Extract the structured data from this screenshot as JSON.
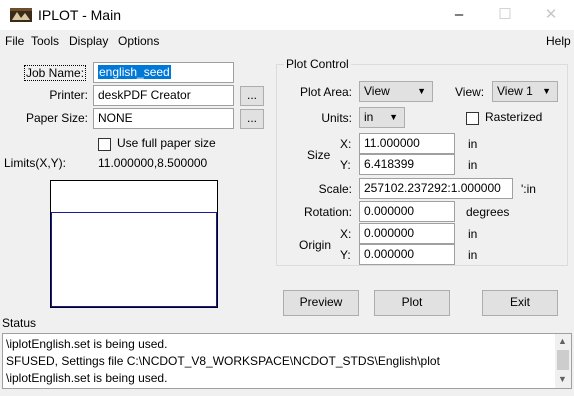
{
  "window": {
    "title": "IPLOT - Main",
    "minimize_glyph": "–",
    "maximize_glyph": "☐",
    "close_glyph": "✕"
  },
  "menu": {
    "file": "File",
    "tools": "Tools",
    "display": "Display",
    "options": "Options",
    "help": "Help"
  },
  "left": {
    "job_name_label": "Job Name:",
    "job_name_value": "english_seed",
    "printer_label": "Printer:",
    "printer_value": "deskPDF Creator",
    "paper_size_label": "Paper Size:",
    "paper_size_value": "NONE",
    "browse_label": "...",
    "use_full_paper_label": "Use full paper size",
    "use_full_paper_checked": false,
    "limits_label": "Limits(X,Y):",
    "limits_value": "11.000000,8.500000"
  },
  "plot_control": {
    "title": "Plot Control",
    "plot_area_label": "Plot Area:",
    "plot_area_value": "View",
    "view_label": "View:",
    "view_value": "View 1",
    "units_label": "Units:",
    "units_value": "in",
    "rasterized_label": "Rasterized",
    "rasterized_checked": false,
    "size_label": "Size",
    "size_x_label": "X:",
    "size_x_value": "11.000000",
    "size_x_unit": "in",
    "size_y_label": "Y:",
    "size_y_value": "6.418399",
    "size_y_unit": "in",
    "scale_label": "Scale:",
    "scale_value": "257102.237292:1.000000",
    "scale_unit": "':in",
    "rotation_label": "Rotation:",
    "rotation_value": "0.000000",
    "rotation_unit": "degrees",
    "origin_label": "Origin",
    "origin_x_label": "X:",
    "origin_x_value": "0.000000",
    "origin_x_unit": "in",
    "origin_y_label": "Y:",
    "origin_y_value": "0.000000",
    "origin_y_unit": "in"
  },
  "buttons": {
    "preview": "Preview",
    "plot": "Plot",
    "exit": "Exit"
  },
  "status": {
    "label": "Status",
    "lines": [
      "\\iplotEnglish.set is being used.",
      "SFUSED, Settings file C:\\NCDOT_V8_WORKSPACE\\NCDOT_STDS\\English\\plot",
      "\\iplotEnglish.set is being used."
    ]
  }
}
